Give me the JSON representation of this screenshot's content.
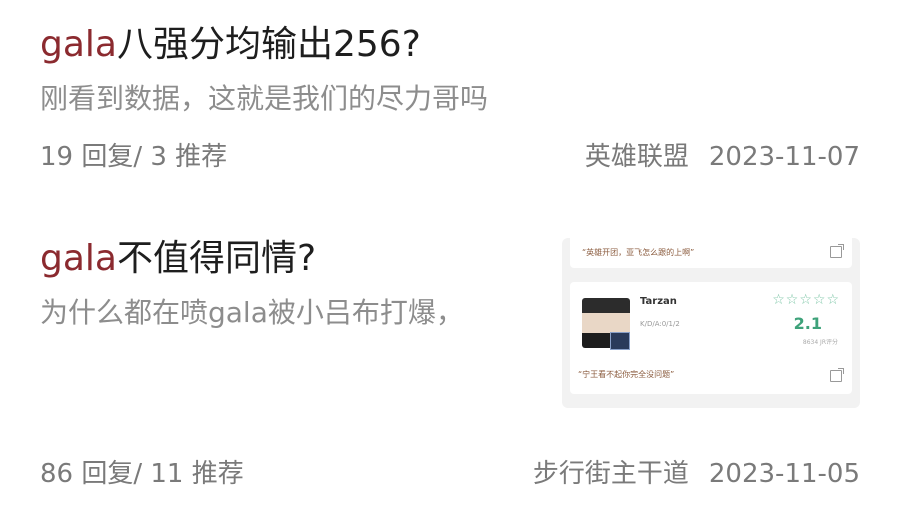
{
  "posts": [
    {
      "title_keyword": "gala",
      "title_rest": "八强分均输出256?",
      "excerpt": "刚看到数据，这就是我们的尽力哥吗",
      "replies": "19 回复/",
      "recommends": "3 推荐",
      "forum": "英雄联盟",
      "date": "2023-11-07"
    },
    {
      "title_keyword": "gala",
      "title_rest": "不值得同情?",
      "excerpt": "为什么都在喷gala被小吕布打爆，",
      "replies": "86 回复/",
      "recommends": "11 推荐",
      "forum": "步行街主干道",
      "date": "2023-11-05",
      "thumbnail": {
        "quote_top": "“英雄开团，亚飞怎么跟的上啊”",
        "player_name": "Tarzan",
        "kda": "K/D/A:0/1/2",
        "stars": "☆☆☆☆☆",
        "score": "2.1",
        "score_sub": "8634 JR评分",
        "quote_bottom": "“宁王看不起你完全没问题”"
      }
    }
  ]
}
